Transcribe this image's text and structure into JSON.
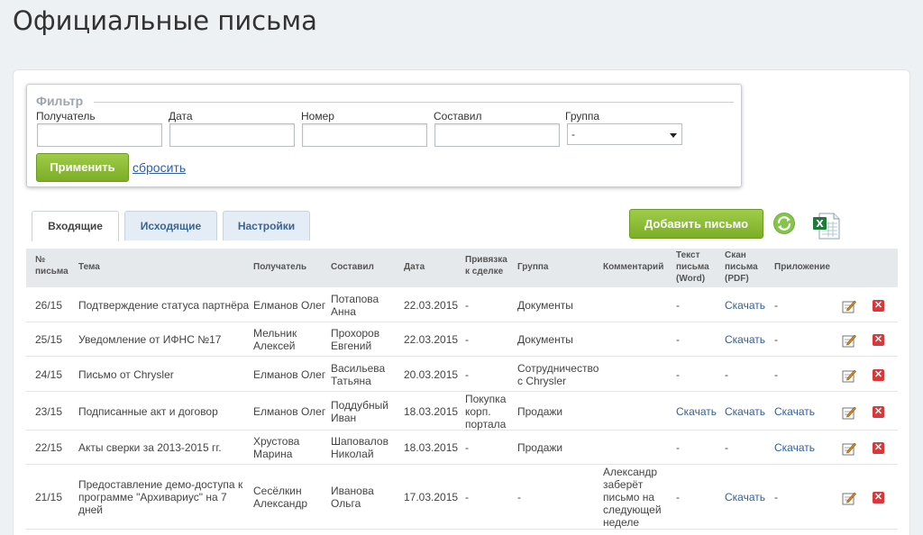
{
  "page": {
    "title": "Официальные письма"
  },
  "filter": {
    "legend": "Фильтр",
    "fields": {
      "recipient": {
        "label": "Получатель",
        "value": ""
      },
      "date": {
        "label": "Дата",
        "value": ""
      },
      "number": {
        "label": "Номер",
        "value": ""
      },
      "author": {
        "label": "Составил",
        "value": ""
      },
      "group": {
        "label": "Группа",
        "selected": "-"
      }
    },
    "apply_label": "Применить",
    "reset_label": "сбросить"
  },
  "tabs": [
    {
      "label": "Входящие",
      "active": true
    },
    {
      "label": "Исходящие",
      "active": false
    },
    {
      "label": "Настройки",
      "active": false
    }
  ],
  "toolbar": {
    "add_label": "Добавить письмо",
    "refresh_icon": "refresh-icon",
    "export_icon": "excel-icon"
  },
  "table": {
    "headers": {
      "num_a": "№",
      "num_b": "письма",
      "subject": "Тема",
      "recipient": "Получатель",
      "author": "Составил",
      "date": "Дата",
      "deal_a": "Привязка",
      "deal_b": "к сделке",
      "group": "Группа",
      "comment": "Комментарий",
      "text_a": "Текст",
      "text_b": "письма",
      "text_c": "(Word)",
      "scan_a": "Скан",
      "scan_b": "письма",
      "scan_c": "(PDF)",
      "attach": "Приложение"
    },
    "rows": [
      {
        "num": "26/15",
        "subject": [
          "Подтверждение статуса партнёра"
        ],
        "recipient": [
          "Елманов Олег"
        ],
        "author": [
          "Потапова",
          "Анна"
        ],
        "date": "22.03.2015",
        "deal": [
          "-"
        ],
        "group": [
          "Документы"
        ],
        "comment": [
          ""
        ],
        "text": "-",
        "scan": "Скачать",
        "attach": "-"
      },
      {
        "num": "25/15",
        "subject": [
          "Уведомление от ИФНС №17"
        ],
        "recipient": [
          "Мельник",
          "Алексей"
        ],
        "author": [
          "Прохоров",
          "Евгений"
        ],
        "date": "22.03.2015",
        "deal": [
          "-"
        ],
        "group": [
          "Документы"
        ],
        "comment": [
          ""
        ],
        "text": "-",
        "scan": "Скачать",
        "attach": "-"
      },
      {
        "num": "24/15",
        "subject": [
          "Письмо от Chrysler"
        ],
        "recipient": [
          "Елманов Олег"
        ],
        "author": [
          "Васильева",
          "Татьяна"
        ],
        "date": "20.03.2015",
        "deal": [
          "-"
        ],
        "group": [
          "Сотрудничество",
          "с Chrysler"
        ],
        "comment": [
          ""
        ],
        "text": "-",
        "scan": "-",
        "attach": "-"
      },
      {
        "num": "23/15",
        "subject": [
          "Подписанные акт и договор"
        ],
        "recipient": [
          "Елманов Олег"
        ],
        "author": [
          "Поддубный",
          "Иван"
        ],
        "date": "18.03.2015",
        "deal": [
          "Покупка",
          "корп.",
          "портала"
        ],
        "group": [
          "Продажи"
        ],
        "comment": [
          ""
        ],
        "text": "Скачать",
        "scan": "Скачать",
        "attach": "Скачать"
      },
      {
        "num": "22/15",
        "subject": [
          "Акты сверки за 2013-2015 гг."
        ],
        "recipient": [
          "Хрустова",
          "Марина"
        ],
        "author": [
          "Шаповалов",
          "Николай"
        ],
        "date": "18.03.2015",
        "deal": [
          "-"
        ],
        "group": [
          "Продажи"
        ],
        "comment": [
          ""
        ],
        "text": "-",
        "scan": "-",
        "attach": "Скачать"
      },
      {
        "num": "21/15",
        "subject": [
          "Предоставление демо-доступа к",
          "программе \"Архивариус\" на 7",
          "дней"
        ],
        "recipient": [
          "Сесёлкин",
          "Александр"
        ],
        "author": [
          "Иванова",
          "Ольга"
        ],
        "date": "17.03.2015",
        "deal": [
          "-"
        ],
        "group": [
          "-"
        ],
        "comment": [
          "Александр",
          "заберёт",
          "письмо на",
          "следующей",
          "неделе"
        ],
        "text": "-",
        "scan": "Скачать",
        "attach": "-"
      }
    ]
  }
}
